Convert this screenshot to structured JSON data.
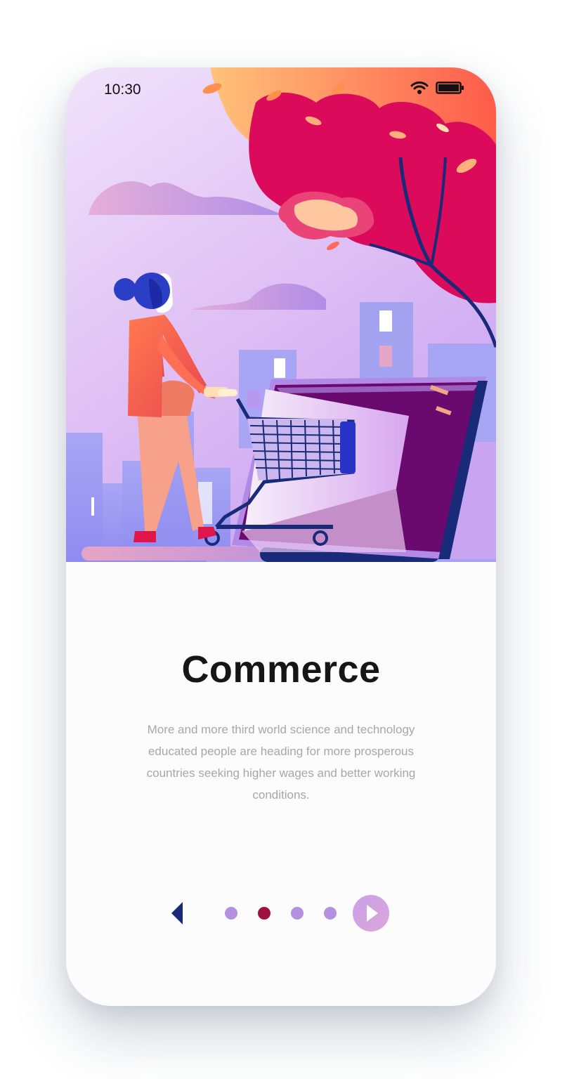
{
  "status_bar": {
    "time": "10:30",
    "wifi_icon": "wifi-icon",
    "battery_icon": "battery-icon"
  },
  "onboarding": {
    "title": "Commerce",
    "description": "More and more third world science and technology educated people are heading for more prosperous countries seeking higher wages and better working conditions."
  },
  "pager": {
    "prev_icon": "chevron-left-icon",
    "next_icon": "chevron-right-icon",
    "page_count": 4,
    "active_index": 1
  },
  "colors": {
    "accent": "#a0103f",
    "dot": "#b58fe0",
    "title": "#161616",
    "description": "#a7a7ab",
    "hero_top": "#eedff8",
    "hero_bottom": "#c49bf0"
  }
}
